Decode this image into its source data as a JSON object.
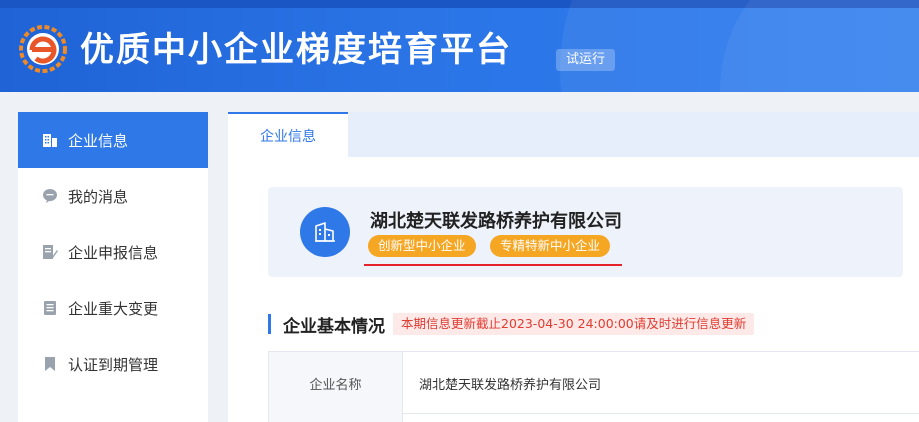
{
  "header": {
    "title": "优质中小企业梯度培育平台",
    "badge": "试运行"
  },
  "sidebar": {
    "items": [
      {
        "label": "企业信息",
        "icon": "building-icon",
        "active": true
      },
      {
        "label": "我的消息",
        "icon": "message-icon",
        "active": false
      },
      {
        "label": "企业申报信息",
        "icon": "edit-document-icon",
        "active": false
      },
      {
        "label": "企业重大变更",
        "icon": "document-list-icon",
        "active": false
      },
      {
        "label": "认证到期管理",
        "icon": "bookmark-icon",
        "active": false
      }
    ]
  },
  "main": {
    "tabs": [
      {
        "label": "企业信息"
      }
    ],
    "company": {
      "name": "湖北楚天联发路桥养护有限公司",
      "tags": [
        "创新型中小企业",
        "专精特新中小企业"
      ]
    },
    "section": {
      "title": "企业基本情况",
      "notice": "本期信息更新截止2023-04-30 24:00:00请及时进行信息更新"
    },
    "table": {
      "rows": [
        {
          "label": "企业名称",
          "value": "湖北楚天联发路桥养护有限公司"
        }
      ]
    }
  },
  "colors": {
    "primary": "#2f78e8",
    "tag": "#f5a623",
    "notice_text": "#e03c31",
    "underline": "#e6232a"
  }
}
